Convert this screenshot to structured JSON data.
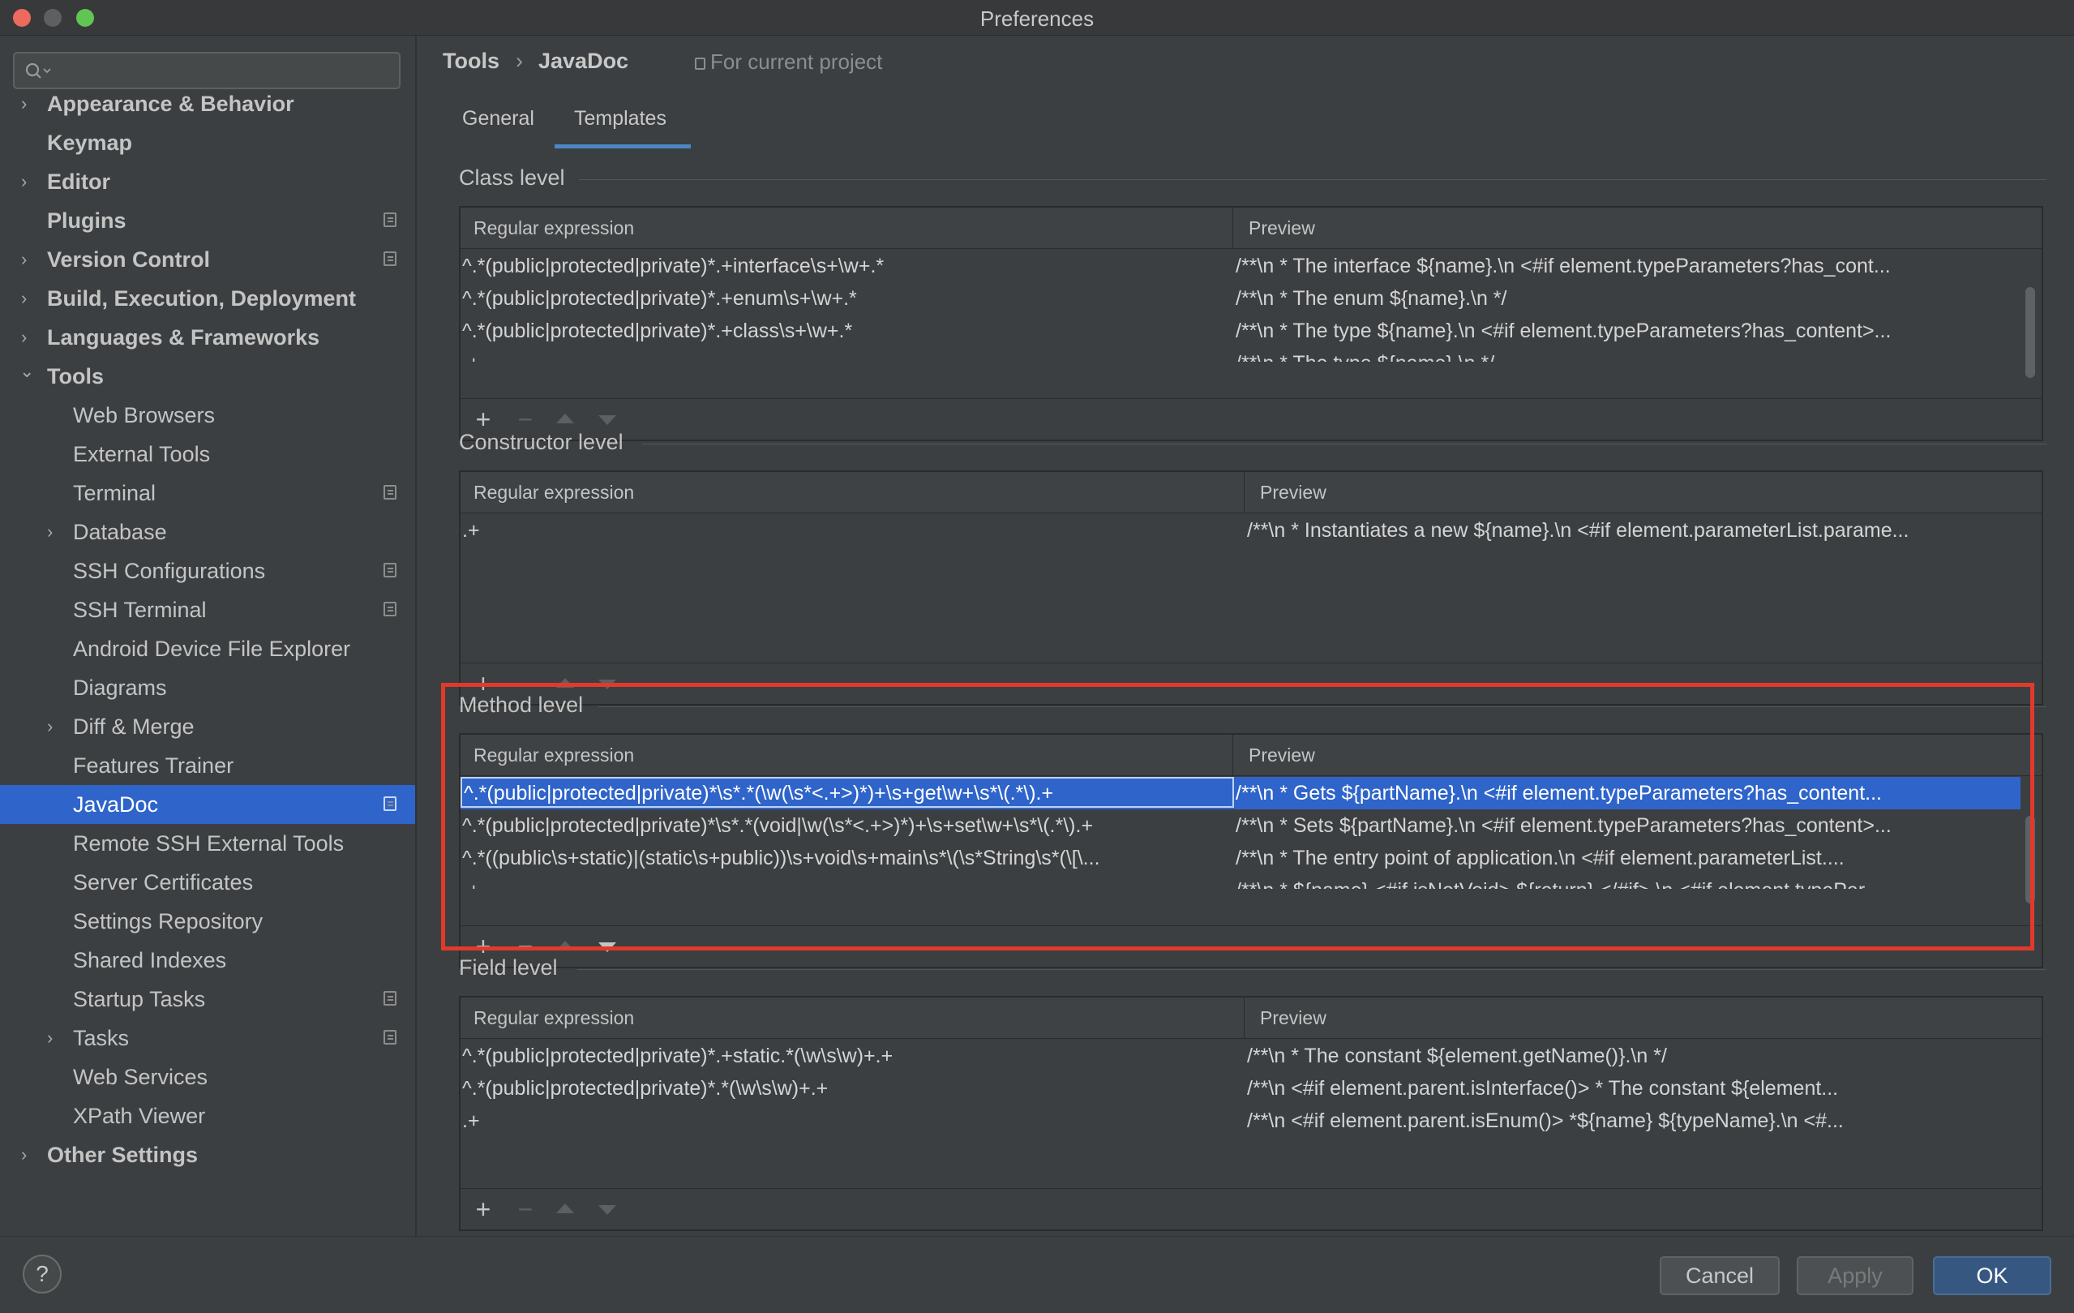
{
  "window": {
    "title": "Preferences"
  },
  "search": {
    "placeholder": ""
  },
  "sidebar": {
    "items": [
      {
        "label": "Appearance & Behavior",
        "chevron": "›"
      },
      {
        "label": "Keymap",
        "chevron": ""
      },
      {
        "label": "Editor",
        "chevron": "›"
      },
      {
        "label": "Plugins",
        "chevron": ""
      },
      {
        "label": "Version Control",
        "chevron": "›"
      },
      {
        "label": "Build, Execution, Deployment",
        "chevron": "›"
      },
      {
        "label": "Languages & Frameworks",
        "chevron": "›"
      },
      {
        "label": "Tools",
        "chevron": "⌄"
      },
      {
        "label": "Web Browsers",
        "chevron": ""
      },
      {
        "label": "External Tools",
        "chevron": ""
      },
      {
        "label": "Terminal",
        "chevron": ""
      },
      {
        "label": "Database",
        "chevron": "›"
      },
      {
        "label": "SSH Configurations",
        "chevron": ""
      },
      {
        "label": "SSH Terminal",
        "chevron": ""
      },
      {
        "label": "Android Device File Explorer",
        "chevron": ""
      },
      {
        "label": "Diagrams",
        "chevron": ""
      },
      {
        "label": "Diff & Merge",
        "chevron": "›"
      },
      {
        "label": "Features Trainer",
        "chevron": ""
      },
      {
        "label": "JavaDoc",
        "chevron": ""
      },
      {
        "label": "Remote SSH External Tools",
        "chevron": ""
      },
      {
        "label": "Server Certificates",
        "chevron": ""
      },
      {
        "label": "Settings Repository",
        "chevron": ""
      },
      {
        "label": "Shared Indexes",
        "chevron": ""
      },
      {
        "label": "Startup Tasks",
        "chevron": ""
      },
      {
        "label": "Tasks",
        "chevron": "›"
      },
      {
        "label": "Web Services",
        "chevron": ""
      },
      {
        "label": "XPath Viewer",
        "chevron": ""
      },
      {
        "label": "Other Settings",
        "chevron": "›"
      }
    ]
  },
  "breadcrumb": {
    "root": "Tools",
    "sep": "›",
    "leaf": "JavaDoc",
    "scope": "For current project"
  },
  "tabs": {
    "general": "General",
    "templates": "Templates"
  },
  "columns": {
    "regex": "Regular expression",
    "preview": "Preview"
  },
  "toolbar_icons": {
    "add": "+",
    "remove": "−"
  },
  "sections": {
    "class": {
      "title": "Class level",
      "rows": [
        {
          "regex": "^.*(public|protected|private)*.+interface\\s+\\w+.*",
          "preview": "/**\\n  * The interface ${name}.\\n <#if element.typeParameters?has_cont..."
        },
        {
          "regex": "^.*(public|protected|private)*.+enum\\s+\\w+.*",
          "preview": "/**\\n  * The enum ${name}.\\n  */"
        },
        {
          "regex": "^.*(public|protected|private)*.+class\\s+\\w+.*",
          "preview": "/**\\n  * The type ${name}.\\n <#if element.typeParameters?has_content>..."
        },
        {
          "regex": ".+",
          "preview": "/**\\n  * The type ${name}.\\n  */"
        }
      ]
    },
    "constructor": {
      "title": "Constructor level",
      "rows": [
        {
          "regex": ".+",
          "preview": "/**\\n  * Instantiates a new ${name}.\\n <#if element.parameterList.parame..."
        }
      ]
    },
    "method": {
      "title": "Method level",
      "rows": [
        {
          "regex": "^.*(public|protected|private)*\\s*.*(\\w(\\s*<.+>)*)+\\s+get\\w+\\s*\\(.*\\).+",
          "preview": "/**\\n  * Gets ${partName}.\\n <#if element.typeParameters?has_content..."
        },
        {
          "regex": "^.*(public|protected|private)*\\s*.*(void|\\w(\\s*<.+>)*)+\\s+set\\w+\\s*\\(.*\\).+",
          "preview": "/**\\n  * Sets ${partName}.\\n <#if element.typeParameters?has_content>..."
        },
        {
          "regex": "^.*((public\\s+static)|(static\\s+public))\\s+void\\s+main\\s*\\(\\s*String\\s*(\\[\\...",
          "preview": "/**\\n  * The entry point of application.\\n       <#if element.parameterList...."
        },
        {
          "regex": ".+",
          "preview": "/**\\n  * ${name} <#if isNotVoid> ${return} </#if> \\n <#if element.typePar..."
        }
      ]
    },
    "field": {
      "title": "Field level",
      "rows": [
        {
          "regex": "^.*(public|protected|private)*.+static.*(\\w\\s\\w)+.+",
          "preview": "/**\\n  * The constant ${element.getName()}.\\n  */"
        },
        {
          "regex": "^.*(public|protected|private)*.*(\\w\\s\\w)+.+",
          "preview": "/**\\n     <#if element.parent.isInterface()>        * The constant ${element..."
        },
        {
          "regex": ".+",
          "preview": "/**\\n     <#if element.parent.isEnum()>        *${name} ${typeName}.\\n <#..."
        }
      ]
    }
  },
  "buttons": {
    "help": "?",
    "cancel": "Cancel",
    "apply": "Apply",
    "ok": "OK"
  },
  "colors": {
    "selection": "#2f65ca",
    "highlight_border": "#e03a2c",
    "ok_button": "#365880"
  }
}
